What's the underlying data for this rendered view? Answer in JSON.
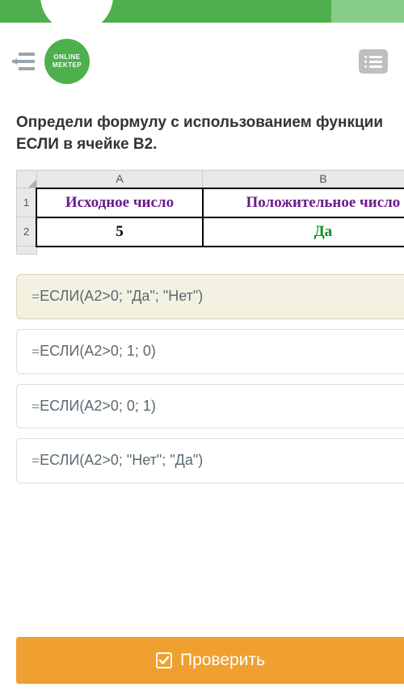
{
  "logo": {
    "line1": "ONLINE",
    "line2": "MEKTEP"
  },
  "question": "Определи формулу с использованием функции ЕСЛИ в ячейке B2.",
  "table": {
    "colA": "A",
    "colB": "B",
    "row1": "1",
    "row2": "2",
    "a1": "Исходное число",
    "b1": "Положительное число",
    "a2": "5",
    "b2": "Да"
  },
  "options": [
    {
      "text": "ЕСЛИ(A2>0; \"Да\"; \"Нет\")",
      "selected": true
    },
    {
      "text": "ЕСЛИ(A2>0; 1; 0)",
      "selected": false
    },
    {
      "text": "ЕСЛИ(A2>0; 0; 1)",
      "selected": false
    },
    {
      "text": "ЕСЛИ(A2>0; \"Нет\"; \"Да\")",
      "selected": false
    }
  ],
  "check_button": "Проверить"
}
